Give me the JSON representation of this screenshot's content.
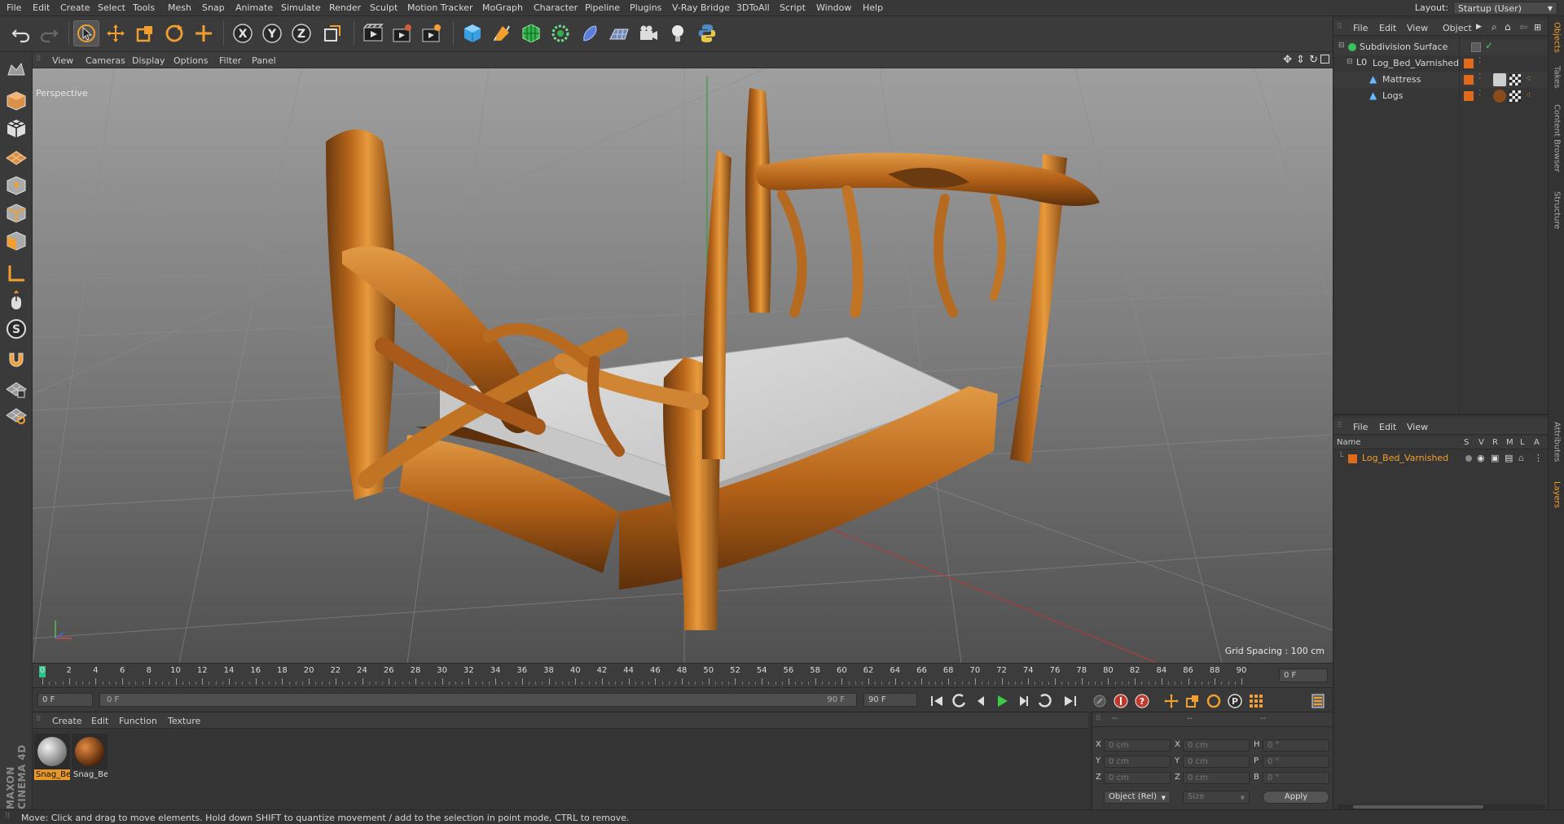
{
  "menubar": {
    "items": [
      "File",
      "Edit",
      "Create",
      "Select",
      "Tools",
      "Mesh",
      "Snap",
      "Animate",
      "Simulate",
      "Render",
      "Sculpt",
      "Motion Tracker",
      "MoGraph",
      "Character",
      "Pipeline",
      "Plugins",
      "V-Ray Bridge",
      "3DToAll",
      "Script",
      "Window",
      "Help"
    ],
    "layout_label": "Layout:",
    "layout_value": "Startup (User)"
  },
  "toolbar": {
    "icons": [
      "undo-icon",
      "redo-icon",
      "live-selection-icon",
      "move-icon",
      "scale-icon",
      "rotate-icon",
      "add-object-icon",
      "x-axis-icon",
      "y-axis-icon",
      "z-axis-icon",
      "coordinate-system-icon",
      "render-view-icon",
      "render-picture-viewer-icon",
      "edit-render-settings-icon",
      "cube-icon",
      "pen-icon",
      "subdivision-icon",
      "cloner-icon",
      "deformer-icon",
      "floor-icon",
      "camera-icon",
      "light-icon",
      "python-icon"
    ]
  },
  "viewport": {
    "menu": [
      "View",
      "Cameras",
      "Display",
      "Options",
      "Filter",
      "Panel"
    ],
    "camera_label": "Perspective",
    "grid_spacing": "Grid Spacing : 100 cm"
  },
  "timeline": {
    "ticks": [
      "0",
      "2",
      "4",
      "6",
      "8",
      "10",
      "12",
      "14",
      "16",
      "18",
      "20",
      "22",
      "24",
      "26",
      "28",
      "30",
      "32",
      "34",
      "36",
      "38",
      "40",
      "42",
      "44",
      "46",
      "48",
      "50",
      "52",
      "54",
      "56",
      "58",
      "60",
      "62",
      "64",
      "66",
      "68",
      "70",
      "72",
      "74",
      "76",
      "78",
      "80",
      "82",
      "84",
      "86",
      "88",
      "90"
    ],
    "current_frame_field": "0 F",
    "start_frame": "0 F",
    "range_start": "0 F",
    "range_end": "90 F",
    "end_frame": "90 F",
    "end_field": "90 F"
  },
  "material_manager": {
    "menu": [
      "Create",
      "Edit",
      "Function",
      "Texture"
    ],
    "materials": [
      {
        "name": "Snag_Be",
        "selected": true
      },
      {
        "name": "Snag_Be",
        "selected": false
      }
    ]
  },
  "coordinates": {
    "header": [
      "--",
      "--",
      "--"
    ],
    "rows": [
      {
        "a": "X",
        "a_val": "0 cm",
        "b": "X",
        "b_val": "0 cm",
        "c": "H",
        "c_val": "0 °"
      },
      {
        "a": "Y",
        "a_val": "0 cm",
        "b": "Y",
        "b_val": "0 cm",
        "c": "P",
        "c_val": "0 °"
      },
      {
        "a": "Z",
        "a_val": "0 cm",
        "b": "Z",
        "b_val": "0 cm",
        "c": "B",
        "c_val": "0 °"
      }
    ],
    "mode": "Object (Rel)",
    "size_mode": "Size",
    "apply_label": "Apply"
  },
  "status": {
    "text": "Move: Click and drag to move elements. Hold down SHIFT to quantize movement / add to the selection in point mode, CTRL to remove."
  },
  "object_manager": {
    "menu": [
      "File",
      "Edit",
      "View",
      "Object"
    ],
    "objects": [
      {
        "name": "Subdivision Surface",
        "indent": 0
      },
      {
        "name": "Log_Bed_Varnished",
        "indent": 1
      },
      {
        "name": "Mattress",
        "indent": 2
      },
      {
        "name": "Logs",
        "indent": 2
      }
    ]
  },
  "layer_manager": {
    "menu": [
      "File",
      "Edit",
      "View"
    ],
    "columns": [
      "Name",
      "S",
      "V",
      "R",
      "M",
      "L",
      "A"
    ],
    "layers": [
      {
        "name": "Log_Bed_Varnished",
        "color": "#e06a1c"
      }
    ]
  },
  "side_tabs": [
    "Objects",
    "Takes",
    "Content Browser",
    "Structure",
    "Attributes",
    "Layers"
  ],
  "branding": "MAXON CINEMA 4D",
  "colors": {
    "accent": "#f29f2f",
    "selection": "#e79826",
    "layer_orange": "#e06a1c"
  }
}
